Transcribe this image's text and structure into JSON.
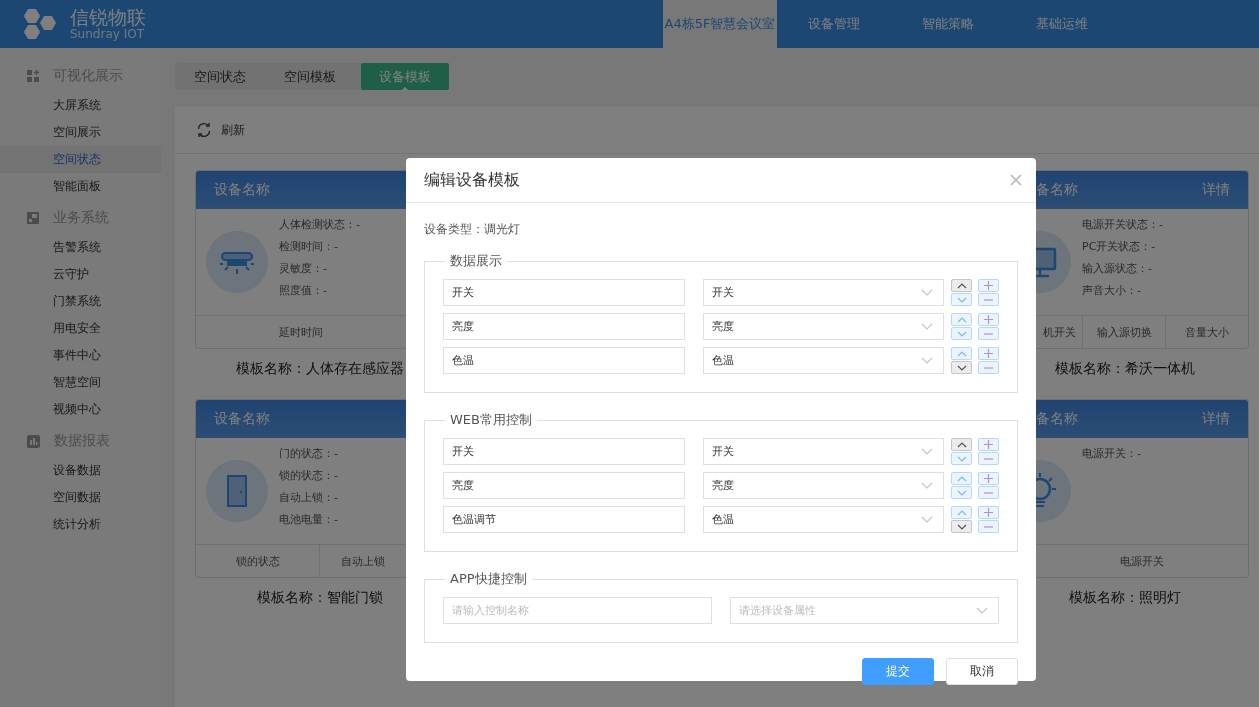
{
  "brand": {
    "name": "信锐物联",
    "subtitle": "Sundray IOT"
  },
  "top_nav": [
    {
      "label": "A4栋5F智慧会议室",
      "selected": true
    },
    {
      "label": "设备管理",
      "selected": false
    },
    {
      "label": "智能策略",
      "selected": false
    },
    {
      "label": "基础运维",
      "selected": false
    }
  ],
  "sidebar": [
    {
      "label": "可视化展示",
      "children": [
        {
          "label": "大屏系统",
          "selected": false
        },
        {
          "label": "空间展示",
          "selected": false
        },
        {
          "label": "空间状态",
          "selected": true
        },
        {
          "label": "智能面板",
          "selected": false
        }
      ]
    },
    {
      "label": "业务系统",
      "children": [
        {
          "label": "告警系统",
          "selected": false
        },
        {
          "label": "云守护",
          "selected": false
        },
        {
          "label": "门禁系统",
          "selected": false
        },
        {
          "label": "用电安全",
          "selected": false
        },
        {
          "label": "事件中心",
          "selected": false
        },
        {
          "label": "智慧空间",
          "selected": false
        },
        {
          "label": "视频中心",
          "selected": false
        }
      ]
    },
    {
      "label": "数据报表",
      "children": [
        {
          "label": "设备数据",
          "selected": false
        },
        {
          "label": "空间数据",
          "selected": false
        },
        {
          "label": "统计分析",
          "selected": false
        }
      ]
    }
  ],
  "tabs": [
    {
      "label": "空间状态",
      "selected": false
    },
    {
      "label": "空间模板",
      "selected": false
    },
    {
      "label": "设备模板",
      "selected": true
    }
  ],
  "toolbar": {
    "refresh": "刷新"
  },
  "cards_left": [
    {
      "title": "设备名称",
      "properties": [
        "人体检测状态：-",
        "检测时间：-",
        "灵敏度：-",
        "照度值：-"
      ],
      "actions": [
        "延时时间"
      ],
      "template": "模板名称：人体存在感应器"
    },
    {
      "title": "设备名称",
      "properties": [
        "门的状态：-",
        "锁的状态：-",
        "自动上锁：-",
        "电池电量：-"
      ],
      "actions": [
        "锁的状态",
        "自动上锁"
      ],
      "template": "模板名称：智能门锁"
    }
  ],
  "cards_right": [
    {
      "title": "备名称",
      "detail": "详情",
      "properties": [
        "电源开关状态：-",
        "PC开关状态：-",
        "输入源状态：-",
        "声音大小：-"
      ],
      "actions": [
        "机开关",
        "输入源切换",
        "音量大小"
      ],
      "template": "模板名称：希沃一体机"
    },
    {
      "title": "备名称",
      "detail": "详情",
      "properties": [
        "电源开关：-"
      ],
      "actions": [
        "电源开关"
      ],
      "template": "模板名称：照明灯"
    }
  ],
  "dialog": {
    "title": "编辑设备模板",
    "device_type": "设备类型：调光灯",
    "sections": [
      {
        "legend": "数据展示",
        "rows": [
          {
            "name": "开关",
            "attribute": "开关",
            "up_disabled": true,
            "down_disabled": false
          },
          {
            "name": "亮度",
            "attribute": "亮度",
            "up_disabled": false,
            "down_disabled": false
          },
          {
            "name": "色温",
            "attribute": "色温",
            "up_disabled": false,
            "down_disabled": true
          }
        ]
      },
      {
        "legend": "WEB常用控制",
        "rows": [
          {
            "name": "开关",
            "attribute": "开关",
            "up_disabled": true,
            "down_disabled": false
          },
          {
            "name": "亮度",
            "attribute": "亮度",
            "up_disabled": false,
            "down_disabled": false
          },
          {
            "name": "色温调节",
            "attribute": "色温",
            "up_disabled": false,
            "down_disabled": true
          }
        ]
      }
    ],
    "app_section": {
      "legend": "APP快捷控制",
      "name_placeholder": "请输入控制名称",
      "attribute_placeholder": "请选择设备属性"
    },
    "buttons": [
      {
        "label": "提交",
        "kind": "primary"
      },
      {
        "label": "取消",
        "kind": "default"
      }
    ]
  }
}
